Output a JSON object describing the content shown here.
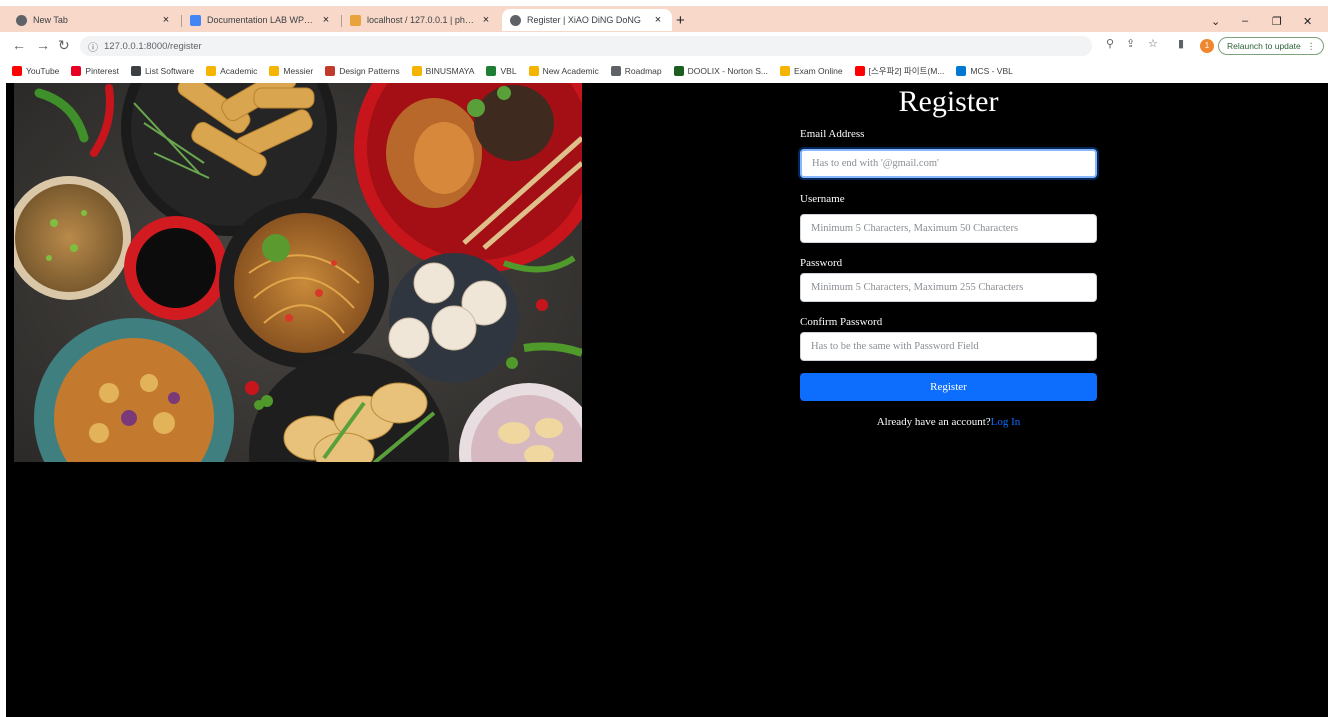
{
  "browser": {
    "tabs": [
      {
        "title": "New Tab",
        "favicon_color": "#5f6368",
        "active": false
      },
      {
        "title": "Documentation LAB WP - Goog...",
        "favicon_color": "#4285f4",
        "active": false
      },
      {
        "title": "localhost / 127.0.0.1 | phpMyAd...",
        "favicon_color": "#e8a33d",
        "active": false
      },
      {
        "title": "Register | XiAO DiNG DoNG",
        "favicon_color": "#5f6368",
        "active": true
      }
    ],
    "url": "127.0.0.1:8000/register",
    "relaunch_label": "Relaunch to update",
    "profile_initial": "1",
    "bookmarks": [
      {
        "label": "YouTube",
        "color": "#ff0000"
      },
      {
        "label": "Pinterest",
        "color": "#e60023"
      },
      {
        "label": "List Software",
        "color": "#3c4043"
      },
      {
        "label": "Academic",
        "color": "#f4b400"
      },
      {
        "label": "Messier",
        "color": "#f4b400"
      },
      {
        "label": "Design Patterns",
        "color": "#c0392b"
      },
      {
        "label": "BINUSMAYA",
        "color": "#f4b400"
      },
      {
        "label": "VBL",
        "color": "#1e7e34"
      },
      {
        "label": "New Academic",
        "color": "#f4b400"
      },
      {
        "label": "Roadmap",
        "color": "#5f6368"
      },
      {
        "label": "DOOLIX - Norton S...",
        "color": "#1b5e20"
      },
      {
        "label": "Exam Online",
        "color": "#f4b400"
      },
      {
        "label": "[스우파2] 파이트(M...",
        "color": "#ff0000"
      },
      {
        "label": "MCS - VBL",
        "color": "#0078d4"
      }
    ]
  },
  "register": {
    "title": "Register",
    "email_label": "Email Address",
    "email_placeholder": "Has to end with '@gmail.com'",
    "username_label": "Username",
    "username_placeholder": "Minimum 5 Characters, Maximum 50 Characters",
    "password_label": "Password",
    "password_placeholder": "Minimum 5 Characters, Maximum 255 Characters",
    "confirm_label": "Confirm Password",
    "confirm_placeholder": "Has to be the same with Password Field",
    "submit_label": "Register",
    "already_text": "Already have an account?",
    "login_link": "Log In"
  },
  "colors": {
    "page_bg": "#000000",
    "primary": "#0d6efd",
    "tabbar_bg": "#f8d8c9"
  }
}
